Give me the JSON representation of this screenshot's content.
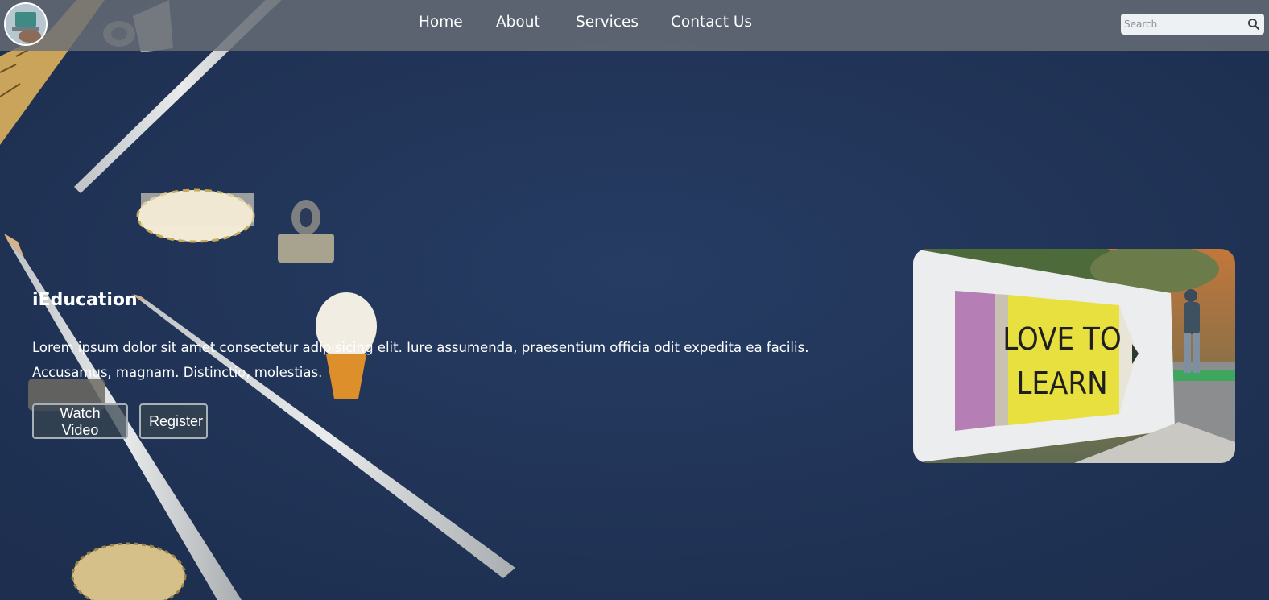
{
  "brand": {
    "logo_icon": "laptop-avatar-logo"
  },
  "nav": {
    "items": [
      {
        "label": "Home"
      },
      {
        "label": "About"
      },
      {
        "label": "Services"
      },
      {
        "label": "Contact Us"
      }
    ]
  },
  "search": {
    "placeholder": "Search",
    "value": "",
    "icon": "search-icon"
  },
  "hero": {
    "title": "iEducation",
    "text": "Lorem ipsum dolor sit amet consectetur adipisicing elit. Iure assumenda, praesentium officia odit expedita ea facilis. Accusamus, magnam. Distinctio, molestias.",
    "buttons": {
      "watch_video": "Watch Video",
      "register": "Register"
    },
    "image_sign_text": [
      "LOVE TO",
      "LEARN"
    ]
  },
  "colors": {
    "background": "#223558",
    "navbar": "#696e76",
    "text": "#ffffff",
    "pencil_yellow": "#e7e03f",
    "pencil_eraser": "#b57fb5"
  }
}
